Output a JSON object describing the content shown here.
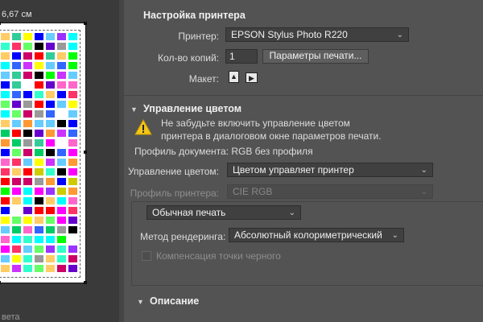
{
  "preview": {
    "size_label": "6,67 см",
    "bottom_fragment": "вета"
  },
  "printer_setup": {
    "title": "Настройка принтера",
    "printer_label": "Принтер:",
    "printer_value": "EPSON Stylus Photo R220",
    "copies_label": "Кол-во копий:",
    "copies_value": "1",
    "print_settings_button": "Параметры печати...",
    "layout_label": "Макет:",
    "layout_icons": [
      "portrait-layout-icon",
      "landscape-layout-icon"
    ]
  },
  "color_management": {
    "title": "Управление цветом",
    "warning_line1": "Не забудьте включить управление цветом",
    "warning_line2": "принтера в диалоговом окне параметров печати.",
    "document_profile": "Профиль документа: RGB без профиля",
    "color_handling_label": "Управление цветом:",
    "color_handling_value": "Цветом управляет принтер",
    "printer_profile_label": "Профиль принтера:",
    "printer_profile_value": "CIE RGB",
    "print_mode_value": "Обычная печать",
    "rendering_label": "Метод рендеринга:",
    "rendering_value": "Абсолютный колориметрический",
    "bpc_label": "Компенсация точки черного"
  },
  "description": {
    "title": "Описание"
  },
  "colors": {
    "background": "#535353",
    "preview_background": "#3a3a3a",
    "warning_yellow": "#f5c518"
  }
}
